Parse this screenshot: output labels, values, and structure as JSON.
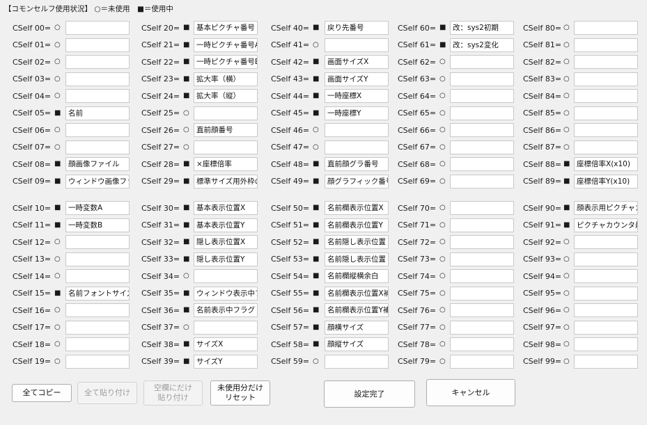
{
  "header": {
    "title": "【コモンセルフ使用状況】",
    "legend": "○＝未使用　■＝使用中"
  },
  "glyphs": {
    "unused": "○",
    "used": "■"
  },
  "columns": [
    {
      "rows": [
        {
          "label": "CSelf 00=",
          "used": false,
          "value": ""
        },
        {
          "label": "CSelf 01=",
          "used": false,
          "value": ""
        },
        {
          "label": "CSelf 02=",
          "used": false,
          "value": ""
        },
        {
          "label": "CSelf 03=",
          "used": false,
          "value": ""
        },
        {
          "label": "CSelf 04=",
          "used": false,
          "value": ""
        },
        {
          "label": "CSelf 05=",
          "used": true,
          "value": "名前"
        },
        {
          "label": "CSelf 06=",
          "used": false,
          "value": ""
        },
        {
          "label": "CSelf 07=",
          "used": false,
          "value": ""
        },
        {
          "label": "CSelf 08=",
          "used": true,
          "value": "顔画像ファイル"
        },
        {
          "label": "CSelf 09=",
          "used": true,
          "value": "ウィンドウ画像ファイル"
        },
        {
          "label": "CSelf 10=",
          "used": true,
          "value": "一時変数A"
        },
        {
          "label": "CSelf 11=",
          "used": true,
          "value": "一時変数B"
        },
        {
          "label": "CSelf 12=",
          "used": false,
          "value": ""
        },
        {
          "label": "CSelf 13=",
          "used": false,
          "value": ""
        },
        {
          "label": "CSelf 14=",
          "used": false,
          "value": ""
        },
        {
          "label": "CSelf 15=",
          "used": true,
          "value": "名前フォントサイズ"
        },
        {
          "label": "CSelf 16=",
          "used": false,
          "value": ""
        },
        {
          "label": "CSelf 17=",
          "used": false,
          "value": ""
        },
        {
          "label": "CSelf 18=",
          "used": false,
          "value": ""
        },
        {
          "label": "CSelf 19=",
          "used": false,
          "value": ""
        }
      ]
    },
    {
      "rows": [
        {
          "label": "CSelf 20=",
          "used": true,
          "value": "基本ピクチャ番号"
        },
        {
          "label": "CSelf 21=",
          "used": true,
          "value": "一時ピクチャ番号A"
        },
        {
          "label": "CSelf 22=",
          "used": true,
          "value": "一時ピクチャ番号B"
        },
        {
          "label": "CSelf 23=",
          "used": true,
          "value": "拡大率（横）"
        },
        {
          "label": "CSelf 24=",
          "used": true,
          "value": "拡大率（縦）"
        },
        {
          "label": "CSelf 25=",
          "used": false,
          "value": ""
        },
        {
          "label": "CSelf 26=",
          "used": false,
          "value": "直前顔番号"
        },
        {
          "label": "CSelf 27=",
          "used": false,
          "value": ""
        },
        {
          "label": "CSelf 28=",
          "used": true,
          "value": "×座標倍率"
        },
        {
          "label": "CSelf 29=",
          "used": true,
          "value": "標準サイズ用外枠の"
        },
        {
          "label": "CSelf 30=",
          "used": true,
          "value": "基本表示位置X"
        },
        {
          "label": "CSelf 31=",
          "used": true,
          "value": "基本表示位置Y"
        },
        {
          "label": "CSelf 32=",
          "used": true,
          "value": "隠し表示位置X"
        },
        {
          "label": "CSelf 33=",
          "used": true,
          "value": "隠し表示位置Y"
        },
        {
          "label": "CSelf 34=",
          "used": false,
          "value": ""
        },
        {
          "label": "CSelf 35=",
          "used": true,
          "value": "ウィンドウ表示中フラグ"
        },
        {
          "label": "CSelf 36=",
          "used": true,
          "value": "名前表示中フラグ"
        },
        {
          "label": "CSelf 37=",
          "used": false,
          "value": ""
        },
        {
          "label": "CSelf 38=",
          "used": true,
          "value": "サイズX"
        },
        {
          "label": "CSelf 39=",
          "used": true,
          "value": "サイズY"
        }
      ]
    },
    {
      "rows": [
        {
          "label": "CSelf 40=",
          "used": true,
          "value": "戻り先番号"
        },
        {
          "label": "CSelf 41=",
          "used": false,
          "value": ""
        },
        {
          "label": "CSelf 42=",
          "used": true,
          "value": "画面サイズX"
        },
        {
          "label": "CSelf 43=",
          "used": true,
          "value": "画面サイズY"
        },
        {
          "label": "CSelf 44=",
          "used": true,
          "value": "一時座標X"
        },
        {
          "label": "CSelf 45=",
          "used": true,
          "value": "一時座標Y"
        },
        {
          "label": "CSelf 46=",
          "used": false,
          "value": ""
        },
        {
          "label": "CSelf 47=",
          "used": false,
          "value": ""
        },
        {
          "label": "CSelf 48=",
          "used": true,
          "value": "直前顔グラ番号"
        },
        {
          "label": "CSelf 49=",
          "used": true,
          "value": "顔グラフィック番号"
        },
        {
          "label": "CSelf 50=",
          "used": true,
          "value": "名前欄表示位置X"
        },
        {
          "label": "CSelf 51=",
          "used": true,
          "value": "名前欄表示位置Y"
        },
        {
          "label": "CSelf 52=",
          "used": true,
          "value": "名前隠し表示位置"
        },
        {
          "label": "CSelf 53=",
          "used": true,
          "value": "名前隠し表示位置"
        },
        {
          "label": "CSelf 54=",
          "used": true,
          "value": "名前欄縦横余白"
        },
        {
          "label": "CSelf 55=",
          "used": true,
          "value": "名前欄表示位置X補正"
        },
        {
          "label": "CSelf 56=",
          "used": true,
          "value": "名前欄表示位置Y補正"
        },
        {
          "label": "CSelf 57=",
          "used": true,
          "value": "顔横サイズ"
        },
        {
          "label": "CSelf 58=",
          "used": true,
          "value": "顔縦サイズ"
        },
        {
          "label": "CSelf 59=",
          "used": false,
          "value": ""
        }
      ]
    },
    {
      "rows": [
        {
          "label": "CSelf 60=",
          "used": true,
          "value": "改：sys2初期"
        },
        {
          "label": "CSelf 61=",
          "used": true,
          "value": "改：sys2変化"
        },
        {
          "label": "CSelf 62=",
          "used": false,
          "value": ""
        },
        {
          "label": "CSelf 63=",
          "used": false,
          "value": ""
        },
        {
          "label": "CSelf 64=",
          "used": false,
          "value": ""
        },
        {
          "label": "CSelf 65=",
          "used": false,
          "value": ""
        },
        {
          "label": "CSelf 66=",
          "used": false,
          "value": ""
        },
        {
          "label": "CSelf 67=",
          "used": false,
          "value": ""
        },
        {
          "label": "CSelf 68=",
          "used": false,
          "value": ""
        },
        {
          "label": "CSelf 69=",
          "used": false,
          "value": ""
        },
        {
          "label": "CSelf 70=",
          "used": false,
          "value": ""
        },
        {
          "label": "CSelf 71=",
          "used": false,
          "value": ""
        },
        {
          "label": "CSelf 72=",
          "used": false,
          "value": ""
        },
        {
          "label": "CSelf 73=",
          "used": false,
          "value": ""
        },
        {
          "label": "CSelf 74=",
          "used": false,
          "value": ""
        },
        {
          "label": "CSelf 75=",
          "used": false,
          "value": ""
        },
        {
          "label": "CSelf 76=",
          "used": false,
          "value": ""
        },
        {
          "label": "CSelf 77=",
          "used": false,
          "value": ""
        },
        {
          "label": "CSelf 78=",
          "used": false,
          "value": ""
        },
        {
          "label": "CSelf 79=",
          "used": false,
          "value": ""
        }
      ]
    },
    {
      "rows": [
        {
          "label": "CSelf 80=",
          "used": false,
          "value": ""
        },
        {
          "label": "CSelf 81=",
          "used": false,
          "value": ""
        },
        {
          "label": "CSelf 82=",
          "used": false,
          "value": ""
        },
        {
          "label": "CSelf 83=",
          "used": false,
          "value": ""
        },
        {
          "label": "CSelf 84=",
          "used": false,
          "value": ""
        },
        {
          "label": "CSelf 85=",
          "used": false,
          "value": ""
        },
        {
          "label": "CSelf 86=",
          "used": false,
          "value": ""
        },
        {
          "label": "CSelf 87=",
          "used": false,
          "value": ""
        },
        {
          "label": "CSelf 88=",
          "used": true,
          "value": "座標倍率X(x10)"
        },
        {
          "label": "CSelf 89=",
          "used": true,
          "value": "座標倍率Y(x10)"
        },
        {
          "label": "CSelf 90=",
          "used": true,
          "value": "顔表示用ピクチャカウンタ"
        },
        {
          "label": "CSelf 91=",
          "used": true,
          "value": "ピクチャカウンタ最大"
        },
        {
          "label": "CSelf 92=",
          "used": false,
          "value": ""
        },
        {
          "label": "CSelf 93=",
          "used": false,
          "value": ""
        },
        {
          "label": "CSelf 94=",
          "used": false,
          "value": ""
        },
        {
          "label": "CSelf 95=",
          "used": false,
          "value": ""
        },
        {
          "label": "CSelf 96=",
          "used": false,
          "value": ""
        },
        {
          "label": "CSelf 97=",
          "used": false,
          "value": ""
        },
        {
          "label": "CSelf 98=",
          "used": false,
          "value": ""
        },
        {
          "label": "CSelf 99=",
          "used": false,
          "value": ""
        }
      ]
    }
  ],
  "buttons": {
    "copy_all": "全てコピー",
    "paste_all": "全て貼り付け",
    "paste_empty": "空欄にだけ\n貼り付け",
    "reset_unused": "未使用分だけ\nリセット",
    "done": "設定完了",
    "cancel": "キャンセル"
  }
}
